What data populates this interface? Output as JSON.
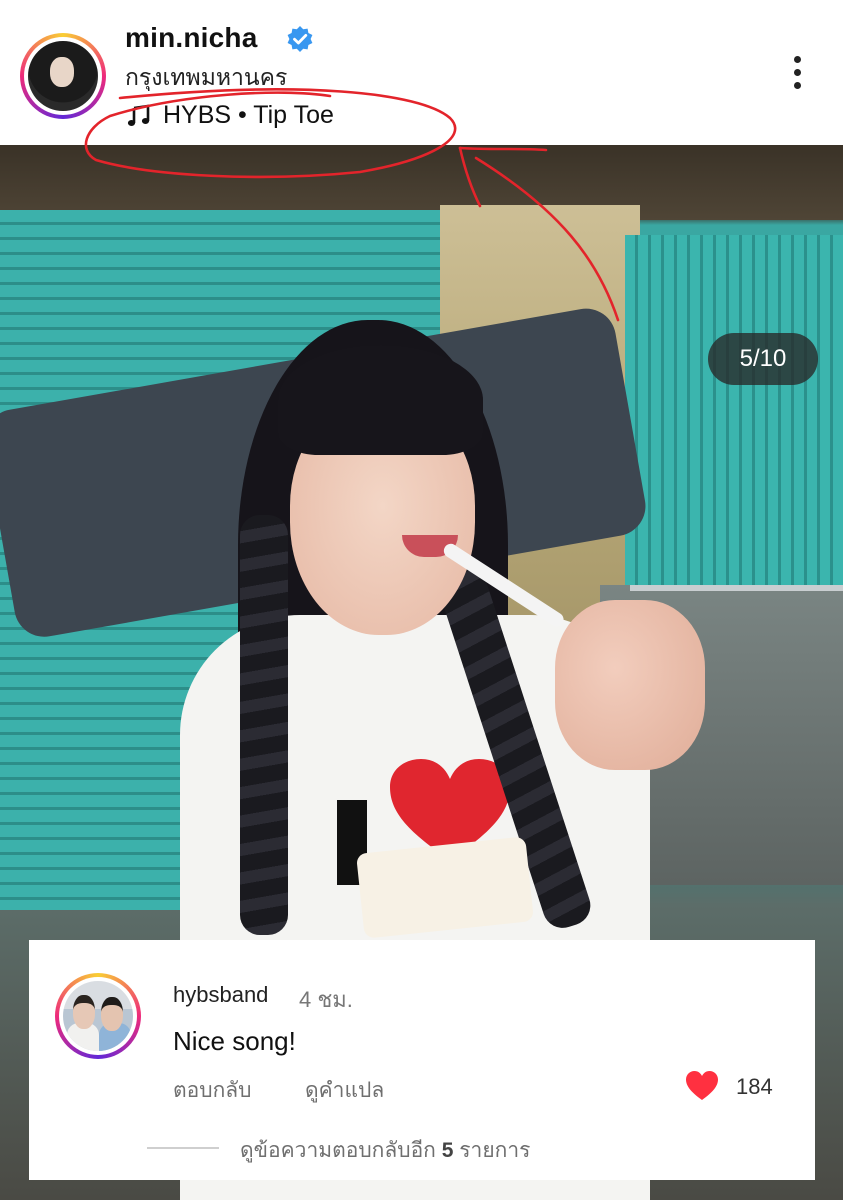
{
  "post_header": {
    "username": "min.nicha",
    "location": "กรุงเทพมหานคร",
    "music": "HYBS • Tip Toe",
    "icons": {
      "verified": "verified-badge-icon",
      "music": "music-note-icon",
      "more": "more-vertical-icon"
    }
  },
  "photo": {
    "counter": "5/10"
  },
  "comment": {
    "username": "hybsband",
    "time": "4 ชม.",
    "text": "Nice song!",
    "reply_label": "ตอบกลับ",
    "translate_label": "ดูคำแปล",
    "likes": "184",
    "view_replies_prefix": "ดูข้อความตอบกลับอีก",
    "view_replies_count": "5",
    "view_replies_suffix": "รายการ"
  },
  "colors": {
    "verified_blue": "#3897f0",
    "heart_red": "#ff3040",
    "annotation_red": "#e3242b",
    "story_ring_gradient": [
      "#f9ce34",
      "#ee2a7b",
      "#6228d7"
    ]
  }
}
